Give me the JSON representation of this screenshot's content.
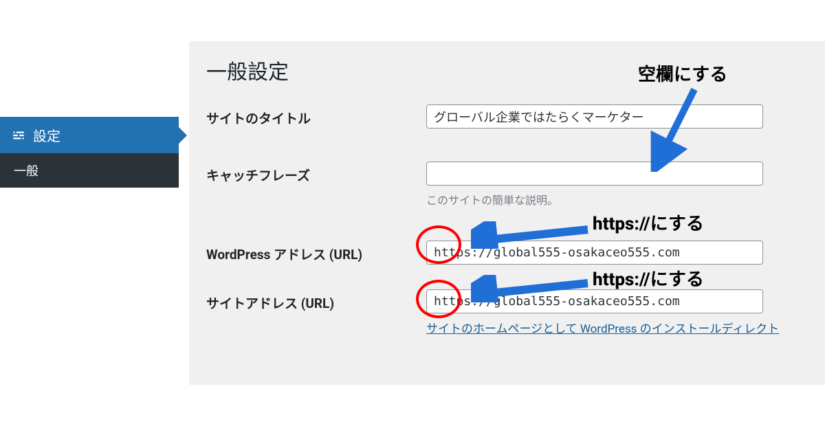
{
  "sidebar": {
    "settings_label": "設定",
    "general_label": "一般"
  },
  "page": {
    "title": "一般設定"
  },
  "fields": {
    "site_title": {
      "label": "サイトのタイトル",
      "value": "グローバル企業ではたらくマーケター"
    },
    "tagline": {
      "label": "キャッチフレーズ",
      "value": "",
      "description": "このサイトの簡単な説明。"
    },
    "wp_address": {
      "label": "WordPress アドレス (URL)",
      "value": "https://global555-osakaceo555.com"
    },
    "site_address": {
      "label": "サイトアドレス (URL)",
      "value": "https://global555-osakaceo555.com",
      "link_text": "サイトのホームページとして WordPress のインストールディレクト"
    }
  },
  "annotations": {
    "empty_note": "空欄にする",
    "https_note_1": "https://にする",
    "https_note_2": "https://にする"
  }
}
